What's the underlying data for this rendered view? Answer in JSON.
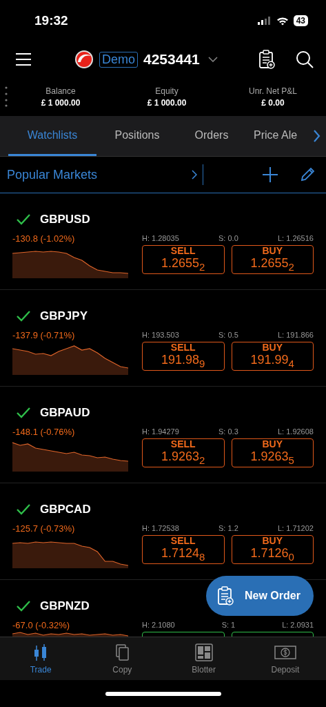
{
  "status_bar": {
    "time": "19:32",
    "battery": "43"
  },
  "header": {
    "badge": "Demo",
    "account": "4253441"
  },
  "summary": [
    {
      "label": "Balance",
      "value": "£ 1 000.00"
    },
    {
      "label": "Equity",
      "value": "£ 1 000.00"
    },
    {
      "label": "Unr. Net P&L",
      "value": "£ 0.00"
    }
  ],
  "tabs": [
    {
      "label": "Watchlists",
      "selected": true
    },
    {
      "label": "Positions",
      "selected": false
    },
    {
      "label": "Orders",
      "selected": false
    },
    {
      "label": "Price Ale",
      "selected": false
    }
  ],
  "watchlist": {
    "title": "Popular Markets"
  },
  "markets": [
    {
      "symbol": "GBPUSD",
      "checked": true,
      "change": "-130.8 (-1.02%)",
      "high": "H: 1.28035",
      "spread": "S: 0.0",
      "low": "L: 1.26516",
      "rising": false,
      "sell_label": "SELL",
      "sell": "1.2655$_{2}$",
      "buy_label": "BUY",
      "buy": "1.2655$_{2}$"
    },
    {
      "symbol": "GBPJPY",
      "checked": true,
      "change": "-137.9 (-0.71%)",
      "high": "H: 193.503",
      "spread": "S: 0.5",
      "low": "L: 191.866",
      "rising": false,
      "sell_label": "SELL",
      "sell": "191.98$_{9}$",
      "buy_label": "BUY",
      "buy": "191.99$_{4}$"
    },
    {
      "symbol": "GBPAUD",
      "checked": true,
      "change": "-148.1 (-0.76%)",
      "high": "H: 1.94279",
      "spread": "S: 0.3",
      "low": "L: 1.92608",
      "rising": false,
      "sell_label": "SELL",
      "sell": "1.9263$_{2}$",
      "buy_label": "BUY",
      "buy": "1.9263$_{5}$"
    },
    {
      "symbol": "GBPCAD",
      "checked": true,
      "change": "-125.7 (-0.73%)",
      "high": "H: 1.72538",
      "spread": "S: 1.2",
      "low": "L: 1.71202",
      "rising": false,
      "sell_label": "SELL",
      "sell": "1.7124$_{8}$",
      "buy_label": "BUY",
      "buy": "1.7126$_{0}$"
    },
    {
      "symbol": "GBPNZD",
      "checked": true,
      "change": "-67.0 (-0.32%)",
      "high": "H: 2.1080",
      "spread": "S: 1",
      "low": "L: 2.0931",
      "rising": true
    }
  ],
  "new_order": {
    "label": "New Order"
  },
  "bottom_nav": [
    {
      "label": "Trade",
      "selected": true
    },
    {
      "label": "Copy",
      "selected": false
    },
    {
      "label": "Blotter",
      "selected": false
    },
    {
      "label": "Deposit",
      "selected": false
    }
  ]
}
